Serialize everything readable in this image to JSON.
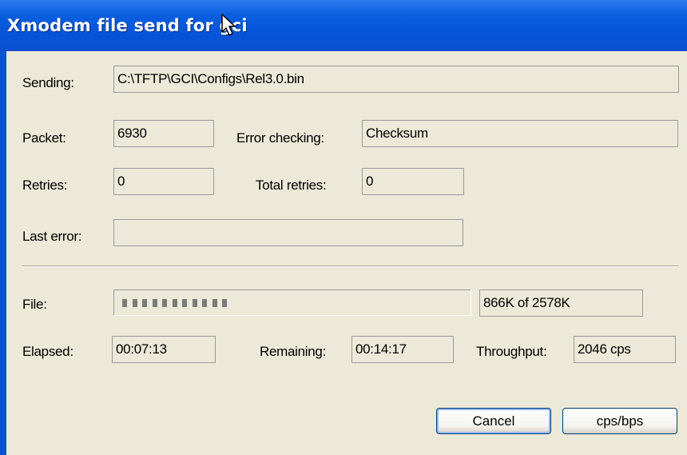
{
  "window": {
    "title": "Xmodem file send for gci"
  },
  "fields": {
    "sending_label": "Sending:",
    "sending_value": "C:\\TFTP\\GCI\\Configs\\Rel3.0.bin",
    "packet_label": "Packet:",
    "packet_value": "6930",
    "error_checking_label": "Error checking:",
    "error_checking_value": "Checksum",
    "retries_label": "Retries:",
    "retries_value": "0",
    "total_retries_label": "Total retries:",
    "total_retries_value": "0",
    "last_error_label": "Last error:",
    "last_error_value": ""
  },
  "progress": {
    "file_label": "File:",
    "sent": "866K of 2578K",
    "fraction": 0.336,
    "segments": 11
  },
  "timing": {
    "elapsed_label": "Elapsed:",
    "elapsed_value": "00:07:13",
    "remaining_label": "Remaining:",
    "remaining_value": "00:14:17",
    "throughput_label": "Throughput:",
    "throughput_value": "2046 cps"
  },
  "buttons": {
    "cancel": "Cancel",
    "cps_bps": "cps/bps"
  },
  "colors": {
    "titlebar": "#0753d8",
    "client": "#ece9d8",
    "progress_segment": "#7a7a7a"
  },
  "icons": {
    "cursor": "mouse-pointer-icon"
  }
}
